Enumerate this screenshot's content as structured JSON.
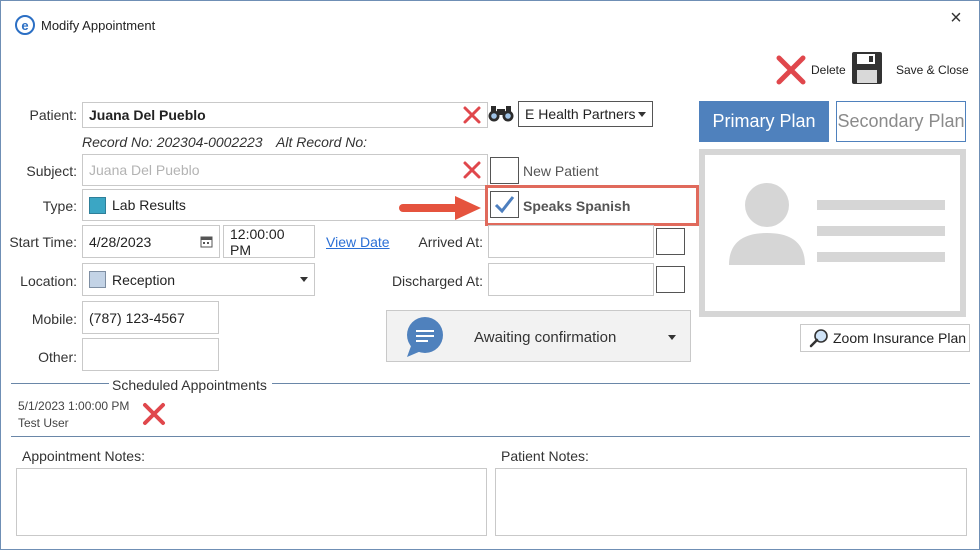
{
  "window": {
    "title": "Modify Appointment",
    "close": "×"
  },
  "toolbar": {
    "delete_label": "Delete",
    "save_label": "Save & Close"
  },
  "patient": {
    "label": "Patient:",
    "value": "Juana Del Pueblo",
    "record_no": "Record No: 202304-0002223",
    "alt_record": "Alt Record No:",
    "partner": "E Health Partners"
  },
  "subject": {
    "label": "Subject:",
    "value": "Juana Del Pueblo",
    "new_patient": "New Patient"
  },
  "type": {
    "label": "Type:",
    "value": "Lab Results",
    "color": "#3ba6c4",
    "speaks_spanish": "Speaks Spanish"
  },
  "start_time": {
    "label": "Start Time:",
    "date": "4/28/2023",
    "time": "12:00:00 PM",
    "view_date": "View Date"
  },
  "arrived": {
    "label": "Arrived At:"
  },
  "location": {
    "label": "Location:",
    "value": "Reception",
    "color": "#c3d3e6"
  },
  "discharged": {
    "label": "Discharged At:"
  },
  "mobile": {
    "label": "Mobile:",
    "value": "(787) 123-4567"
  },
  "other": {
    "label": "Other:",
    "value": ""
  },
  "status": {
    "value": "Awaiting confirmation"
  },
  "plans": {
    "primary": "Primary Plan",
    "secondary": "Secondary Plan",
    "zoom": "Zoom Insurance Plan"
  },
  "scheduled": {
    "title": "Scheduled Appointments",
    "items": [
      {
        "datetime": "5/1/2023 1:00:00 PM",
        "user": "Test User"
      }
    ]
  },
  "notes": {
    "appointment": "Appointment Notes:",
    "patient": "Patient Notes:"
  },
  "colors": {
    "accent": "#4f81bd",
    "danger": "#e0474c",
    "highlight": "#e06a5c"
  }
}
